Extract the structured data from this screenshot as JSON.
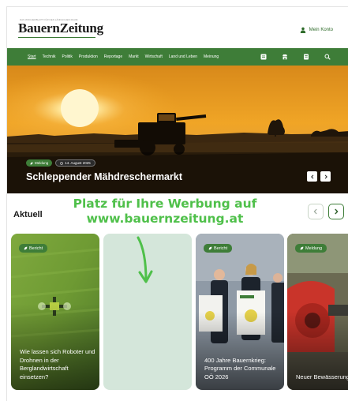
{
  "header": {
    "logo": "BauernZeitung",
    "logo_tagline": "DAS WOCHENBLATT FÜR DEN LÄNDLICHEN RAUM",
    "account_label": "Mein Konto"
  },
  "nav": {
    "items": [
      "Start",
      "Technik",
      "Politik",
      "Produktion",
      "Reportage",
      "Markt",
      "Wirtschaft",
      "Land und Leben",
      "Meinung"
    ],
    "icons": [
      "newspaper-icon",
      "shop-icon",
      "document-icon",
      "search-icon"
    ]
  },
  "hero": {
    "badge_category": "Meldung",
    "badge_date": "14. August 2025",
    "title": "Schleppender Mähdreschermarkt"
  },
  "ad": {
    "line1": "Platz für Ihre Werbung auf",
    "line2": "www.bauernzeitung.at"
  },
  "section": {
    "title": "Aktuell"
  },
  "cards": [
    {
      "badge": "Bericht",
      "title": "Wie lassen sich Roboter und Drohnen in der Berglandwirtschaft einsetzen?"
    },
    {
      "badge": "Bericht",
      "title": "400 Jahre Bauernkrieg: Programm der Communale OÖ 2026"
    },
    {
      "badge": "Meldung",
      "title": "Neuer Bewässerungsteich stärkt Tiroler Obe"
    }
  ],
  "colors": {
    "brand_green": "#3e7d38",
    "ad_green": "#4fc04a",
    "ad_card_bg": "#d4e6da"
  }
}
